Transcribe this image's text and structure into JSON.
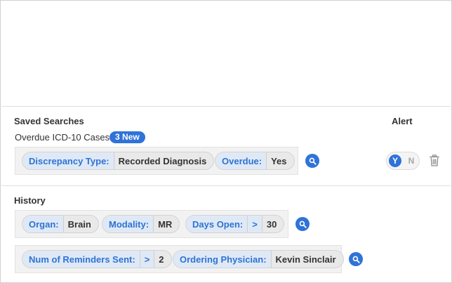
{
  "saved_searches": {
    "heading": "Saved Searches",
    "alert_heading": "Alert",
    "item": {
      "name": "Overdue ICD-10 Cases",
      "badge": "3 New",
      "filters": [
        {
          "key": "Discrepancy Type:",
          "value": "Recorded Diagnosis"
        },
        {
          "key": "Overdue:",
          "value": "Yes"
        }
      ],
      "alert_toggle": {
        "yes_label": "Y",
        "no_label": "N",
        "selected": "Y"
      }
    }
  },
  "history": {
    "heading": "History",
    "rows": [
      {
        "filters": [
          {
            "key": "Organ:",
            "value": "Brain"
          },
          {
            "key": "Modality:",
            "value": "MR"
          },
          {
            "key": "Days Open:",
            "operator": ">",
            "value": "30"
          }
        ]
      },
      {
        "filters": [
          {
            "key": "Num of Reminders Sent:",
            "operator": ">",
            "value": "2"
          },
          {
            "key": "Ordering Physician:",
            "value": "Kevin Sinclair"
          }
        ]
      }
    ]
  },
  "icons": {
    "search": "search-icon",
    "trash": "trash-icon"
  },
  "colors": {
    "accent": "#2f73d8",
    "filter_key_text": "#2e73d3",
    "filter_key_bg": "#dfe9f6"
  }
}
